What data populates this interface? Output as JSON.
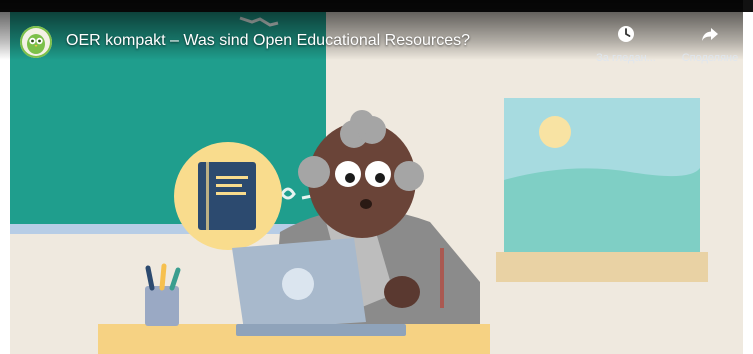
{
  "video": {
    "title": "OER kompakt – Was sind Open Educational Resources?",
    "actions": {
      "watch_later": "За гледан...",
      "share": "Споделяне"
    }
  },
  "colors": {
    "chalkboard": "#1f9e8d",
    "wall": "#efe9df",
    "desk": "#f6d283",
    "book_circle": "#f9dc8d",
    "book": "#2c4a6f",
    "laptop": "#a8b9cc",
    "character_skin": "#6a4438",
    "character_hair": "#a5a5a5",
    "jacket": "#8b8b8b",
    "window_sky": "#a7dbe0",
    "window_sea": "#7fcfc5",
    "sun": "#f8e3a3"
  }
}
